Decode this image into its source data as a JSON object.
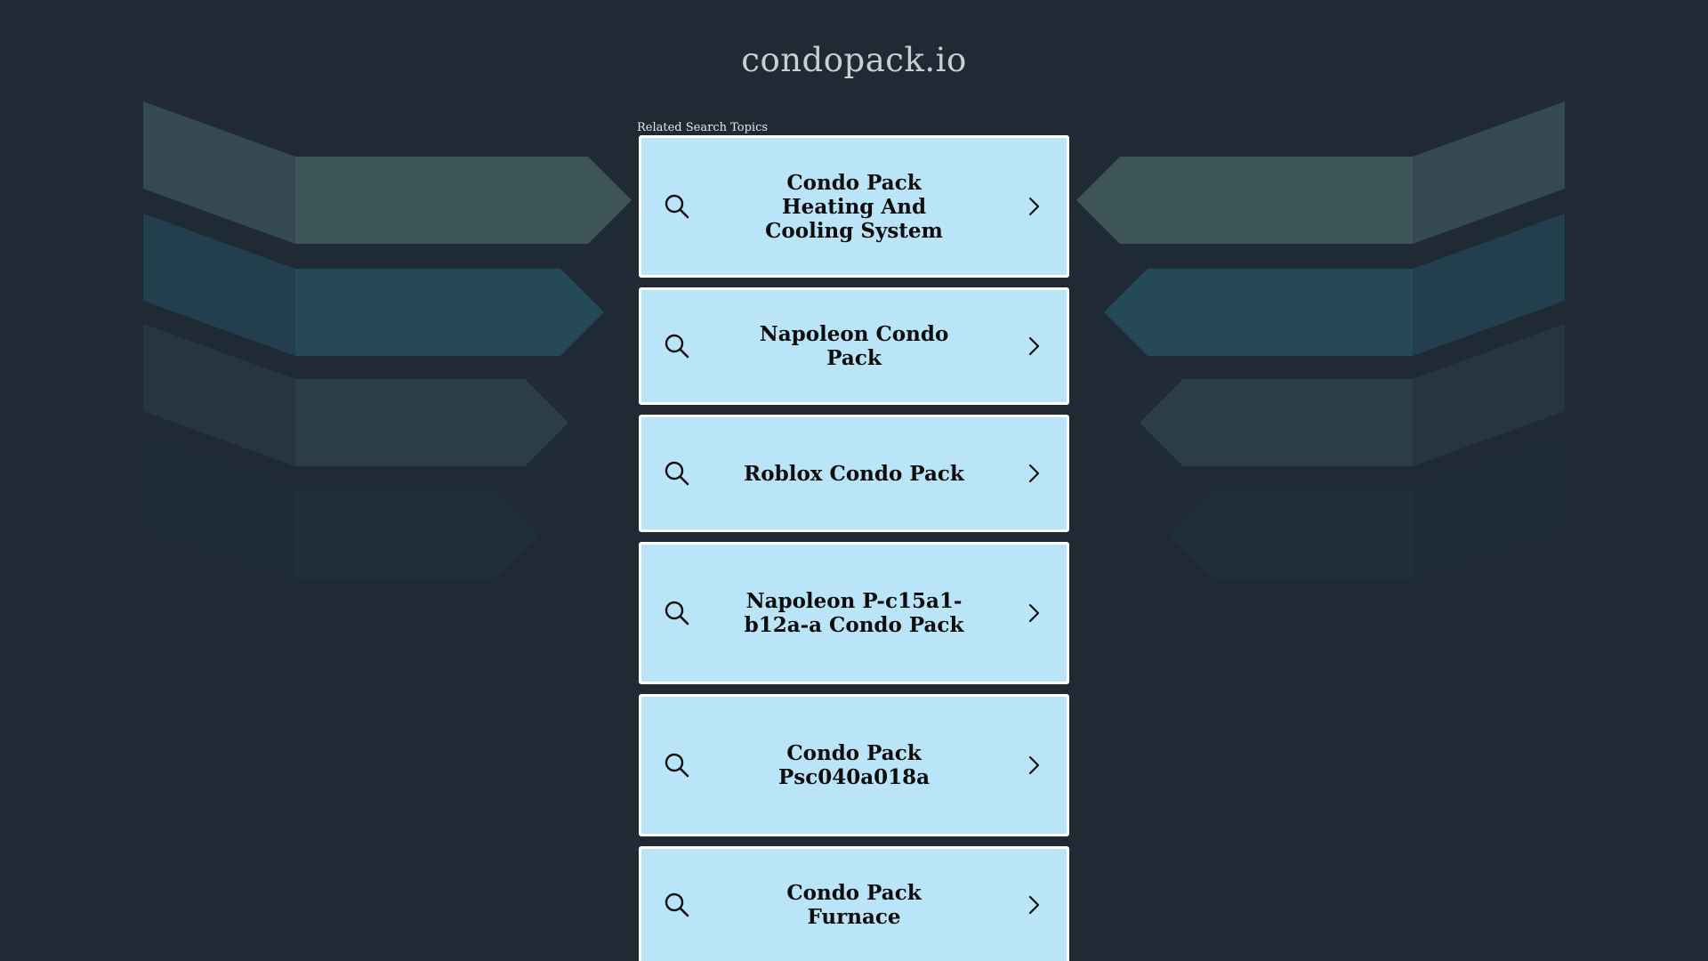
{
  "site": {
    "title": "condopack.io"
  },
  "related": {
    "label": "Related Search Topics"
  },
  "topics": [
    {
      "label": "Condo Pack Heating And Cooling System",
      "icon": "search-icon",
      "arrow": "chevron-right-icon"
    },
    {
      "label": "Napoleon Condo Pack",
      "icon": "search-icon",
      "arrow": "chevron-right-icon"
    },
    {
      "label": "Roblox Condo Pack",
      "icon": "search-icon",
      "arrow": "chevron-right-icon"
    },
    {
      "label": "Napoleon P-c15a1-b12a-a Condo Pack",
      "icon": "search-icon",
      "arrow": "chevron-right-icon"
    },
    {
      "label": "Condo Pack Psc040a018a",
      "icon": "search-icon",
      "arrow": "chevron-right-icon"
    },
    {
      "label": "Condo Pack Furnace",
      "icon": "search-icon",
      "arrow": "chevron-right-icon"
    }
  ],
  "colors": {
    "background": "#1f2a34",
    "tile": "#bae5f9",
    "tile_border": "#ffffff",
    "title": "#c9ced3",
    "wing_row_1": "#3d5559",
    "wing_row_2": "#26495a",
    "wing_row_3": "#2b3d45",
    "wing_row_4": "#1f2f3b"
  }
}
